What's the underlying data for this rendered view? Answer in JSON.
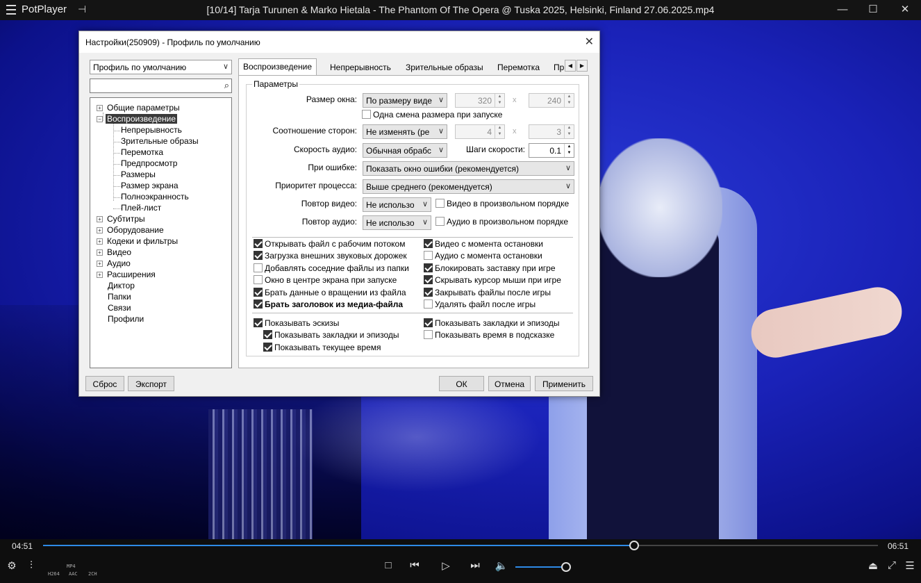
{
  "player": {
    "app_name": "PotPlayer",
    "window_title": "[10/14] Tarja Turunen & Marko Hietala - The Phantom Of The Opera @ Tuska 2025, Helsinki, Finland 27.06.2025.mp4",
    "elapsed": "04:51",
    "total": "06:51",
    "progress_fraction": 0.708,
    "volume_fraction": 0.92,
    "codecs": {
      "video": "H264",
      "container": "MP4",
      "audio": "AAC",
      "channels": "2CH"
    },
    "accent_color": "#2e8ae6"
  },
  "dialog": {
    "title": "Настройки(250909) - Профиль по умолчанию",
    "profile_select": "Профиль по умолчанию",
    "search_placeholder": "",
    "tree": [
      {
        "label": "Общие параметры",
        "expander": "+"
      },
      {
        "label": "Воспроизведение",
        "expander": "−",
        "selected": true
      },
      {
        "label": "Непрерывность"
      },
      {
        "label": "Зрительные образы"
      },
      {
        "label": "Перемотка"
      },
      {
        "label": "Предпросмотр"
      },
      {
        "label": "Размеры"
      },
      {
        "label": "Размер экрана"
      },
      {
        "label": "Полноэкранность"
      },
      {
        "label": "Плей-лист"
      },
      {
        "label": "Субтитры",
        "expander": "+"
      },
      {
        "label": "Оборудование",
        "expander": "+"
      },
      {
        "label": "Кодеки и фильтры",
        "expander": "+"
      },
      {
        "label": "Видео",
        "expander": "+"
      },
      {
        "label": "Аудио",
        "expander": "+"
      },
      {
        "label": "Расширения",
        "expander": "+"
      },
      {
        "label": "Диктор"
      },
      {
        "label": "Папки"
      },
      {
        "label": "Связи"
      },
      {
        "label": "Профили"
      }
    ],
    "tabs": [
      "Воспроизведение",
      "Непрерывность",
      "Зрительные образы",
      "Перемотка",
      "Пр"
    ],
    "group_label": "Параметры",
    "window_size": {
      "label": "Размер окна:",
      "value": "По размеру виде",
      "width": "320",
      "height": "240",
      "x": "x"
    },
    "single_resize": "Одна смена размера при запуске",
    "aspect": {
      "label": "Соотношение сторон:",
      "value": "Не изменять (ре",
      "w": "4",
      "h": "3",
      "x": "x"
    },
    "audio_speed": {
      "label": "Скорость аудио:",
      "value": "Обычная обрабс",
      "step_label": "Шаги скорости:",
      "step_value": "0.1"
    },
    "on_error": {
      "label": "При ошибке:",
      "value": "Показать окно ошибки (рекомендуется)"
    },
    "priority": {
      "label": "Приоритет процесса:",
      "value": "Выше среднего (рекомендуется)"
    },
    "video_repeat": {
      "label": "Повтор видео:",
      "value": "Не использо",
      "shuffle": "Видео в произвольном порядке"
    },
    "audio_repeat": {
      "label": "Повтор аудио:",
      "value": "Не использо",
      "shuffle": "Аудио в произвольном порядке"
    },
    "checks_left": [
      {
        "label": "Открывать файл с рабочим потоком",
        "checked": true
      },
      {
        "label": "Загрузка внешних звуковых дорожек",
        "checked": true
      },
      {
        "label": "Добавлять соседние файлы из папки",
        "checked": false
      },
      {
        "label": "Окно в центре экрана при запуске",
        "checked": false
      },
      {
        "label": "Брать данные о вращении из файла",
        "checked": true
      },
      {
        "label": "Брать заголовок из медиа-файла",
        "checked": true
      }
    ],
    "checks_right": [
      {
        "label": "Видео с момента остановки",
        "checked": true
      },
      {
        "label": "Аудио с момента остановки",
        "checked": false
      },
      {
        "label": "Блокировать заставку при игре",
        "checked": true
      },
      {
        "label": "Скрывать курсор мыши при игре",
        "checked": true
      },
      {
        "label": "Закрывать файлы после игры",
        "checked": true
      },
      {
        "label": "Удалять файл после игры",
        "checked": false
      }
    ],
    "thumbs": {
      "show_thumbs": "Показывать эскизы",
      "show_bookmarks_sub": "Показывать закладки и эпизоды",
      "show_time_sub": "Показывать текущее время",
      "show_bookmarks": "Показывать закладки и эпизоды",
      "show_time_tooltip": "Показывать время в подсказке"
    },
    "buttons": {
      "reset": "Сброс",
      "export": "Экспорт",
      "ok": "ОК",
      "cancel": "Отмена",
      "apply": "Применить"
    }
  }
}
